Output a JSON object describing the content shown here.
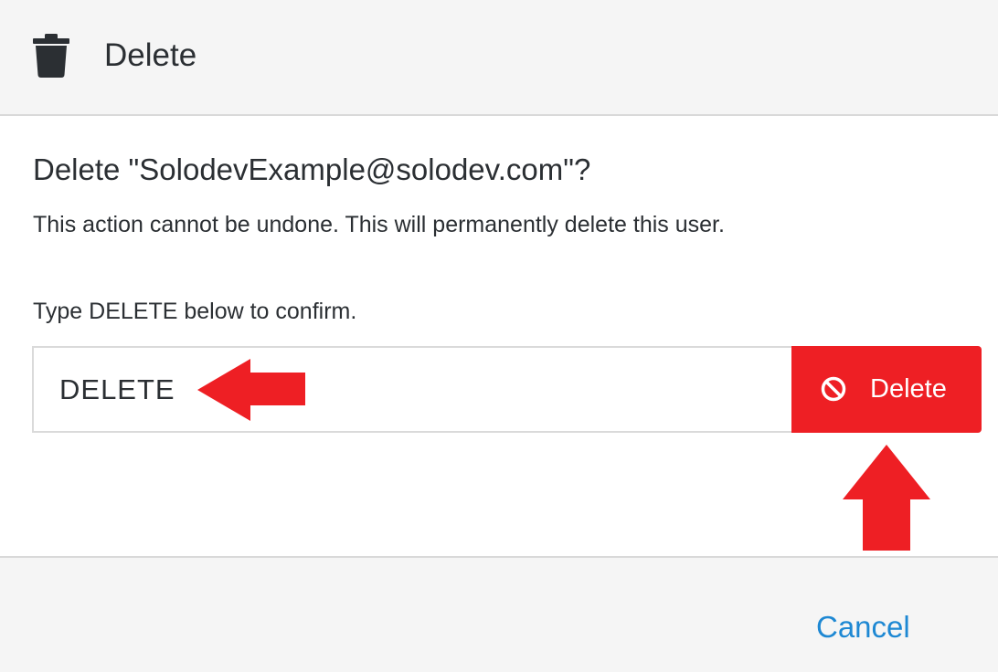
{
  "header": {
    "icon": "trash-icon",
    "title": "Delete"
  },
  "body": {
    "heading": "Delete \"SolodevExample@solodev.com\"?",
    "warning": "This action cannot be undone. This will permanently delete this user.",
    "confirm_label": "Type DELETE below to confirm."
  },
  "confirm": {
    "input_value": "DELETE",
    "button_icon": "ban-icon",
    "button_label": "Delete"
  },
  "annotations": {
    "arrow_color": "#ee1f24",
    "arrow_left_icon": "arrow-left-icon",
    "arrow_up_icon": "arrow-up-icon"
  },
  "footer": {
    "cancel_label": "Cancel"
  },
  "colors": {
    "danger": "#ee1f24",
    "link": "#1e88d3",
    "header_bg": "#f5f5f5",
    "text": "#2b2f33"
  }
}
